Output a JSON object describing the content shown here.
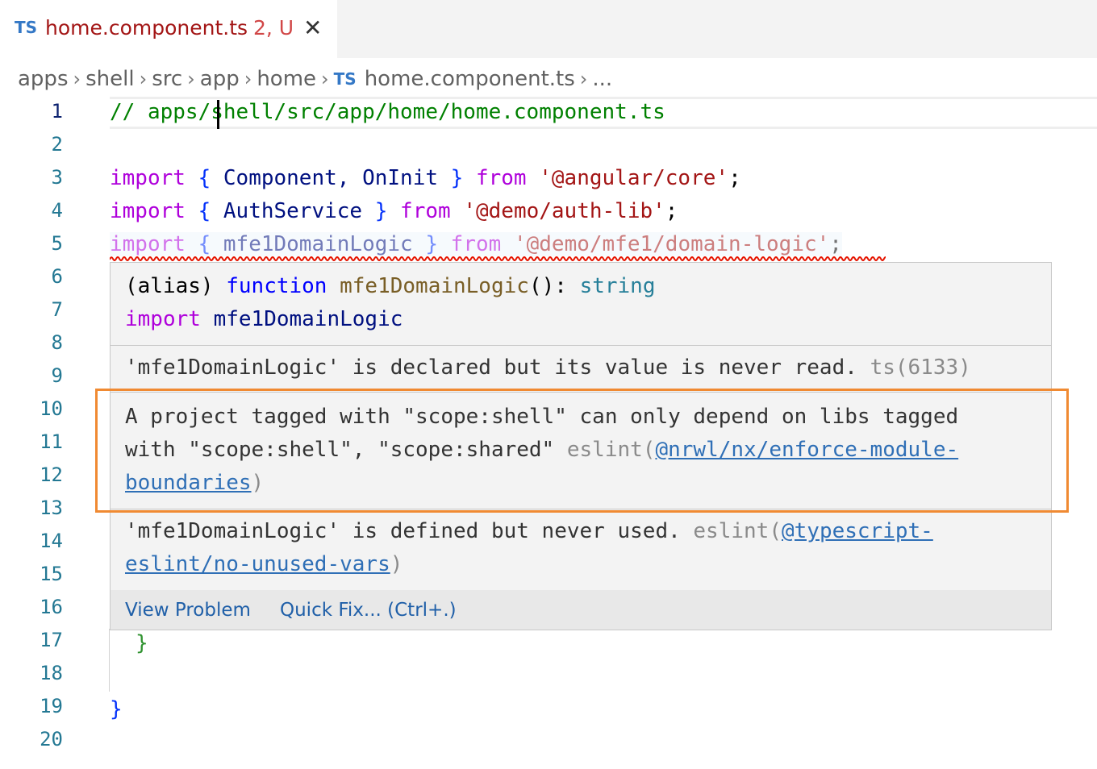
{
  "tab": {
    "lang_badge": "TS",
    "title": "home.component.ts",
    "status": "2, U",
    "close_glyph": "✕"
  },
  "breadcrumb": {
    "items": [
      "apps",
      "shell",
      "src",
      "app",
      "home"
    ],
    "file_badge": "TS",
    "file": "home.component.ts",
    "more": "..."
  },
  "line_numbers": [
    "1",
    "2",
    "3",
    "4",
    "5",
    "6",
    "7",
    "8",
    "9",
    "10",
    "11",
    "12",
    "13",
    "14",
    "15",
    "16",
    "17",
    "18",
    "19",
    "20"
  ],
  "code": {
    "line1": "// apps/shell/src/app/home/home.component.ts",
    "line3": {
      "kw": "import",
      "ob": "{",
      "ids": "Component, OnInit",
      "cb": "}",
      "from": "from",
      "str": "'@angular/core'",
      "semi": ";"
    },
    "line4": {
      "kw": "import",
      "ob": "{",
      "ids": "AuthService",
      "cb": "}",
      "from": "from",
      "str": "'@demo/auth-lib'",
      "semi": ";"
    },
    "line5": {
      "kw": "import",
      "ob": "{",
      "ids": "mfe1DomainLogic",
      "cb": "}",
      "from": "from",
      "str": "'@demo/mfe1/domain-logic'",
      "semi": ";"
    },
    "line17": "}",
    "line19": "}"
  },
  "hover": {
    "sig_line1": {
      "alias": "(alias) ",
      "kw": "function",
      "name": "mfe1DomainLogic",
      "paren": "(): ",
      "type": "string"
    },
    "sig_line2": {
      "kw": "import",
      "name": "mfe1DomainLogic"
    },
    "problem1": {
      "text": "'mfe1DomainLogic' is declared but its value is never read.",
      "source": "ts(6133)"
    },
    "problem2": {
      "line1": "A project tagged with \"scope:shell\" can only depend on libs tagged",
      "line2": "with \"scope:shell\", \"scope:shared\"",
      "source_prefix": "eslint(",
      "rule_part1": "@nrwl/nx/enforce-module-",
      "rule_part2": "boundaries",
      "source_suffix": ")"
    },
    "problem3": {
      "text": "'mfe1DomainLogic' is defined but never used.",
      "source_prefix": "eslint(",
      "rule_part1": "@typescript-",
      "rule_part2": "eslint/no-unused-vars",
      "source_suffix": ")"
    },
    "actions": {
      "view_problem": "View Problem",
      "quick_fix": "Quick Fix... (Ctrl+.)"
    }
  }
}
